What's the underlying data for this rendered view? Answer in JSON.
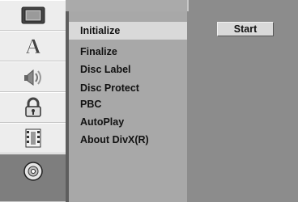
{
  "sidebar": {
    "items": [
      {
        "icon": "tv-screen-icon",
        "selected": false
      },
      {
        "icon": "letter-a-icon",
        "selected": false
      },
      {
        "icon": "speaker-icon",
        "selected": false
      },
      {
        "icon": "padlock-icon",
        "selected": false
      },
      {
        "icon": "film-strip-icon",
        "selected": false
      },
      {
        "icon": "disc-icon",
        "selected": true
      }
    ]
  },
  "menu": {
    "items": [
      {
        "label": "Initialize",
        "selected": true
      },
      {
        "label": "Finalize",
        "selected": false
      },
      {
        "label": "Disc Label",
        "selected": false
      },
      {
        "label": "Disc Protect",
        "selected": false
      },
      {
        "label": "PBC",
        "selected": false
      },
      {
        "label": "AutoPlay",
        "selected": false
      },
      {
        "label": "About DivX(R)",
        "selected": false
      }
    ]
  },
  "action": {
    "start_label": "Start"
  }
}
